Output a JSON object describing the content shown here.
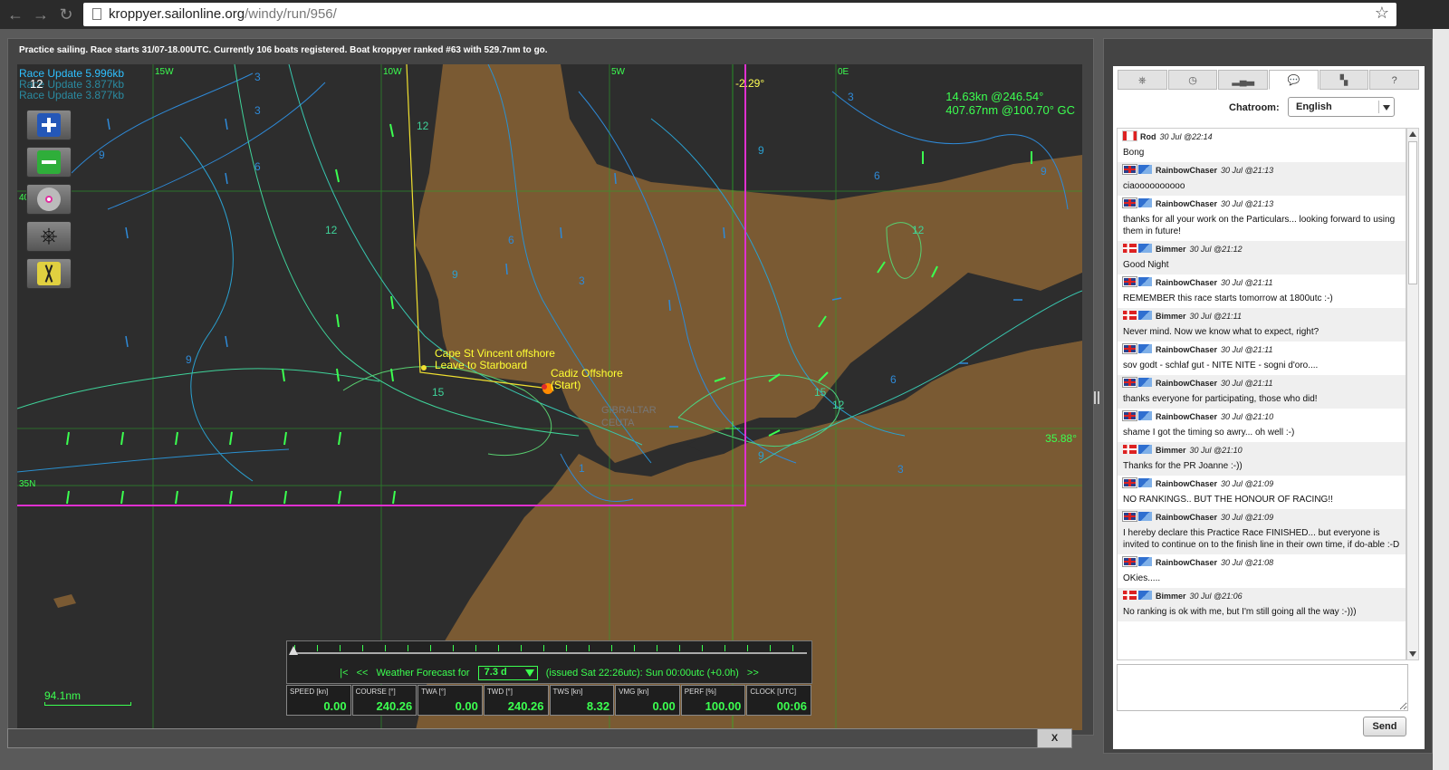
{
  "browser": {
    "url_domain": "kroppyer.sailonline.org",
    "url_path": "/windy/run/956/"
  },
  "status_line": "Practice sailing. Race starts 31/07-18.00UTC. Currently 106 boats registered. Boat kroppyer ranked #63 with 529.7nm to go.",
  "map": {
    "race_updates": [
      "Race Update 5.996kb",
      "Race Update 3.877kb",
      "Race Update 3.877kb"
    ],
    "zoom_level": "12",
    "speed_readout_line1": "14.63kn @246.54°",
    "speed_readout_line2": "407.67nm @100.70° GC",
    "declination": "-2.29°",
    "lat_marker": "35.88°",
    "grid_labels": {
      "lon_15w": "15W",
      "lon_10w": "10W",
      "lon_5w": "5W",
      "lon_0e": "0E",
      "lat_40n": "40N",
      "lat_35n": "35N"
    },
    "waypoints": {
      "cape_line1": "Cape St Vincent offshore",
      "cape_line2": "Leave to Starboard",
      "cadiz_line1": "Cadiz Offshore",
      "cadiz_line2": "(Start)"
    },
    "cities": {
      "gibraltar": "GIBRALTAR",
      "ceuta": "CEUTA"
    },
    "scale_label": "94.1nm",
    "colors": {
      "land": "#7a5a33",
      "sea": "#2d2d2d",
      "grid": "#2aa02a",
      "route": "#f0e030",
      "boundary": "#e030d0",
      "wind_arrow": "#3cff50"
    }
  },
  "tools": [
    {
      "name": "zoom-in-icon"
    },
    {
      "name": "zoom-out-icon"
    },
    {
      "name": "compass-icon"
    },
    {
      "name": "helm-icon"
    },
    {
      "name": "sail-icon"
    }
  ],
  "timeline": {
    "rewind_start": "|<",
    "rewind": "<<",
    "label": "Weather Forecast for",
    "selected": "7.3 d",
    "issued": "(issued Sat 22:26utc): Sun 00:00utc  (+0.0h)",
    "forward": ">>"
  },
  "instruments": [
    {
      "label": "SPEED [kn]",
      "value": "0.00"
    },
    {
      "label": "COURSE [°]",
      "value": "240.26"
    },
    {
      "label": "TWA [°]",
      "value": "0.00"
    },
    {
      "label": "TWD [°]",
      "value": "240.26"
    },
    {
      "label": "TWS [kn]",
      "value": "8.32"
    },
    {
      "label": "VMG [kn]",
      "value": "0.00"
    },
    {
      "label": "PERF [%]",
      "value": "100.00"
    },
    {
      "label": "CLOCK [UTC]",
      "value": "00:06"
    }
  ],
  "close_label": "X",
  "chat": {
    "tabs": [
      {
        "icon": "helm-icon",
        "text": "⎈"
      },
      {
        "icon": "clock-icon",
        "text": "◷"
      },
      {
        "icon": "leaderboard-icon",
        "text": "▂▄▃"
      },
      {
        "icon": "chat-bubble-icon",
        "text": "💬"
      },
      {
        "icon": "flag-icon",
        "text": "▚"
      },
      {
        "icon": "help-icon",
        "text": "?"
      }
    ],
    "room_label": "Chatroom:",
    "room_selected": "English",
    "send_label": "Send",
    "messages": [
      {
        "flag": "ca",
        "club": false,
        "name": "Rod",
        "time": "30 Jul @22:14",
        "text": "Bong"
      },
      {
        "flag": "gb",
        "club": true,
        "name": "RainbowChaser",
        "time": "30 Jul @21:13",
        "text": "ciaoooooooooo"
      },
      {
        "flag": "gb",
        "club": true,
        "name": "RainbowChaser",
        "time": "30 Jul @21:13",
        "text": "thanks for all your work on the Particulars... looking forward to using them in future!"
      },
      {
        "flag": "dk",
        "club": true,
        "name": "Bimmer",
        "time": "30 Jul @21:12",
        "text": "Good Night"
      },
      {
        "flag": "gb",
        "club": true,
        "name": "RainbowChaser",
        "time": "30 Jul @21:11",
        "text": "REMEMBER this race starts tomorrow at 1800utc :-)"
      },
      {
        "flag": "dk",
        "club": true,
        "name": "Bimmer",
        "time": "30 Jul @21:11",
        "text": "Never mind. Now we know what to expect, right?"
      },
      {
        "flag": "gb",
        "club": true,
        "name": "RainbowChaser",
        "time": "30 Jul @21:11",
        "text": "sov godt - schlaf gut - NITE NITE - sogni d'oro...."
      },
      {
        "flag": "gb",
        "club": true,
        "name": "RainbowChaser",
        "time": "30 Jul @21:11",
        "text": "thanks everyone for participating, those who did!"
      },
      {
        "flag": "gb",
        "club": true,
        "name": "RainbowChaser",
        "time": "30 Jul @21:10",
        "text": "shame I got the timing so awry... oh well :-)"
      },
      {
        "flag": "dk",
        "club": true,
        "name": "Bimmer",
        "time": "30 Jul @21:10",
        "text": "Thanks for the PR Joanne :-))"
      },
      {
        "flag": "gb",
        "club": true,
        "name": "RainbowChaser",
        "time": "30 Jul @21:09",
        "text": "NO RANKINGS.. BUT THE HONOUR OF RACING!!"
      },
      {
        "flag": "gb",
        "club": true,
        "name": "RainbowChaser",
        "time": "30 Jul @21:09",
        "text": "I hereby declare this Practice Race FINISHED... but everyone is invited to continue on to the finish line in their own time, if do-able :-D"
      },
      {
        "flag": "gb",
        "club": true,
        "name": "RainbowChaser",
        "time": "30 Jul @21:08",
        "text": "OKies....."
      },
      {
        "flag": "dk",
        "club": true,
        "name": "Bimmer",
        "time": "30 Jul @21:06",
        "text": "No ranking is ok with me, but I'm still going all the way :-)))"
      }
    ]
  }
}
